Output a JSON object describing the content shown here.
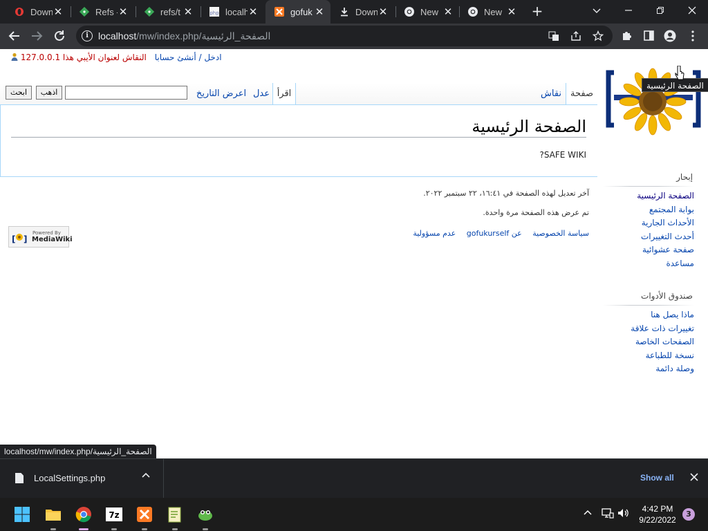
{
  "browser": {
    "tabs": [
      {
        "title": "Down",
        "icon": "opera-icon"
      },
      {
        "title": "Refs -",
        "icon": "git-icon"
      },
      {
        "title": "refs/t",
        "icon": "git-icon"
      },
      {
        "title": "localh",
        "icon": "phpmyadmin-icon"
      },
      {
        "title": "gofuk",
        "icon": "xampp-icon",
        "active": true
      },
      {
        "title": "Down",
        "icon": "download-icon"
      },
      {
        "title": "New",
        "icon": "chrome-icon"
      },
      {
        "title": "New",
        "icon": "chrome-icon"
      }
    ],
    "url_host": "localhost",
    "url_path": "/mw/index.php/الصفحة_الرئيسية",
    "status_url": "localhost/mw/index.php/الصفحة_الرئيسية"
  },
  "wiki": {
    "personal": {
      "ip": "127.0.0.1",
      "talk": "النقاش لعنوان الأيبي هذا",
      "login": "ادخل / أنشئ حسابا"
    },
    "tooltip": "الصفحة الرئيسية",
    "tabs": {
      "page": "صفحة",
      "talk": "نقاش",
      "read": "اقرأ",
      "edit": "عدل",
      "history": "اعرض التاريخ"
    },
    "search": {
      "go": "اذهب",
      "search": "ابحث",
      "value": ""
    },
    "title": "الصفحة الرئيسية",
    "body": "SAFE WIKI?",
    "footer": {
      "last_modified": "آخر تعديل لهذه الصفحة في ١٦:٤١، ٢٢ سبتمبر ٢٠٢٢.",
      "views": "تم عرض هذه الصفحة مرة واحدة.",
      "links": [
        "سياسة الخصوصية",
        "عن gofukurself",
        "عدم مسؤولية"
      ]
    },
    "powered_by": [
      "Powered By",
      "MediaWiki"
    ],
    "navigation": {
      "title": "إبحار",
      "items": [
        "الصفحة الرئيسية",
        "بوابة المجتمع",
        "الأحداث الجارية",
        "أحدث التغييرات",
        "صفحة عشوائية",
        "مساعدة"
      ]
    },
    "toolbox": {
      "title": "صندوق الأدوات",
      "items": [
        "ماذا يصل هنا",
        "تغييرات ذات علاقة",
        "الصفحات الخاصة",
        "نسخة للطباعة",
        "وصلة دائمة"
      ]
    }
  },
  "downloads": {
    "file": "LocalSettings.php",
    "show_all": "Show all"
  },
  "taskbar": {
    "time": "4:42 PM",
    "date": "9/22/2022",
    "notifications": "3"
  }
}
